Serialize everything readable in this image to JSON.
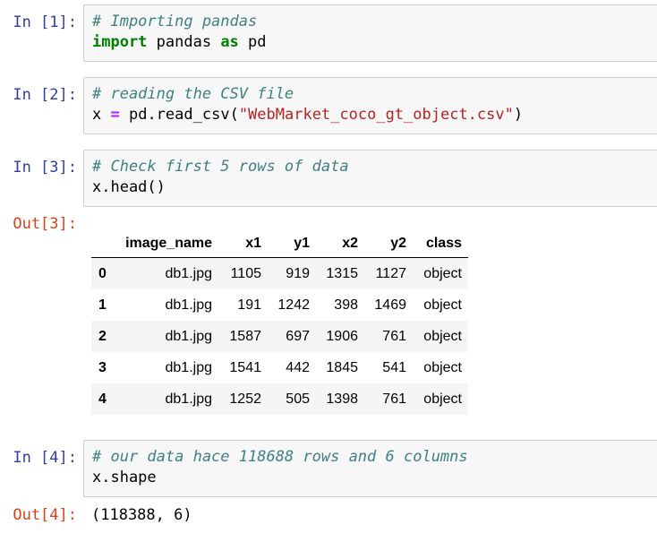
{
  "cells": {
    "c1": {
      "prompt": "In [1]:",
      "comment": "# Importing pandas",
      "kw_import": "import",
      "module": " pandas ",
      "kw_as": "as",
      "alias": " pd"
    },
    "c2": {
      "prompt": "In [2]:",
      "comment": "# reading the CSV file",
      "var": "x ",
      "eq": "=",
      "call": " pd.read_csv",
      "open_paren": "(",
      "arg": "\"WebMarket_coco_gt_object.csv\"",
      "close_paren": ")"
    },
    "c3": {
      "prompt": "In [3]:",
      "comment": "# Check first 5 rows of data",
      "call": "x.head",
      "parens": "()",
      "out_prompt": "Out[3]:"
    },
    "c4": {
      "prompt": "In [4]:",
      "comment": "# our data hace 118688 rows and 6 columns",
      "code": "x.shape",
      "out_prompt": "Out[4]:",
      "output": "(118388, 6)"
    }
  },
  "dataframe": {
    "columns": [
      "",
      "image_name",
      "x1",
      "y1",
      "x2",
      "y2",
      "class"
    ],
    "rows": [
      [
        "0",
        "db1.jpg",
        "1105",
        "919",
        "1315",
        "1127",
        "object"
      ],
      [
        "1",
        "db1.jpg",
        "191",
        "1242",
        "398",
        "1469",
        "object"
      ],
      [
        "2",
        "db1.jpg",
        "1587",
        "697",
        "1906",
        "761",
        "object"
      ],
      [
        "3",
        "db1.jpg",
        "1541",
        "442",
        "1845",
        "541",
        "object"
      ],
      [
        "4",
        "db1.jpg",
        "1252",
        "505",
        "1398",
        "761",
        "object"
      ]
    ]
  },
  "colors": {
    "in_prompt": "#303f9f",
    "out_prompt": "#d84315",
    "comment": "#408080",
    "keyword": "#008000",
    "operator": "#aa22ff",
    "string": "#ba2121",
    "cell_bg": "#f7f7f7",
    "row_stripe": "#f5f5f5"
  }
}
